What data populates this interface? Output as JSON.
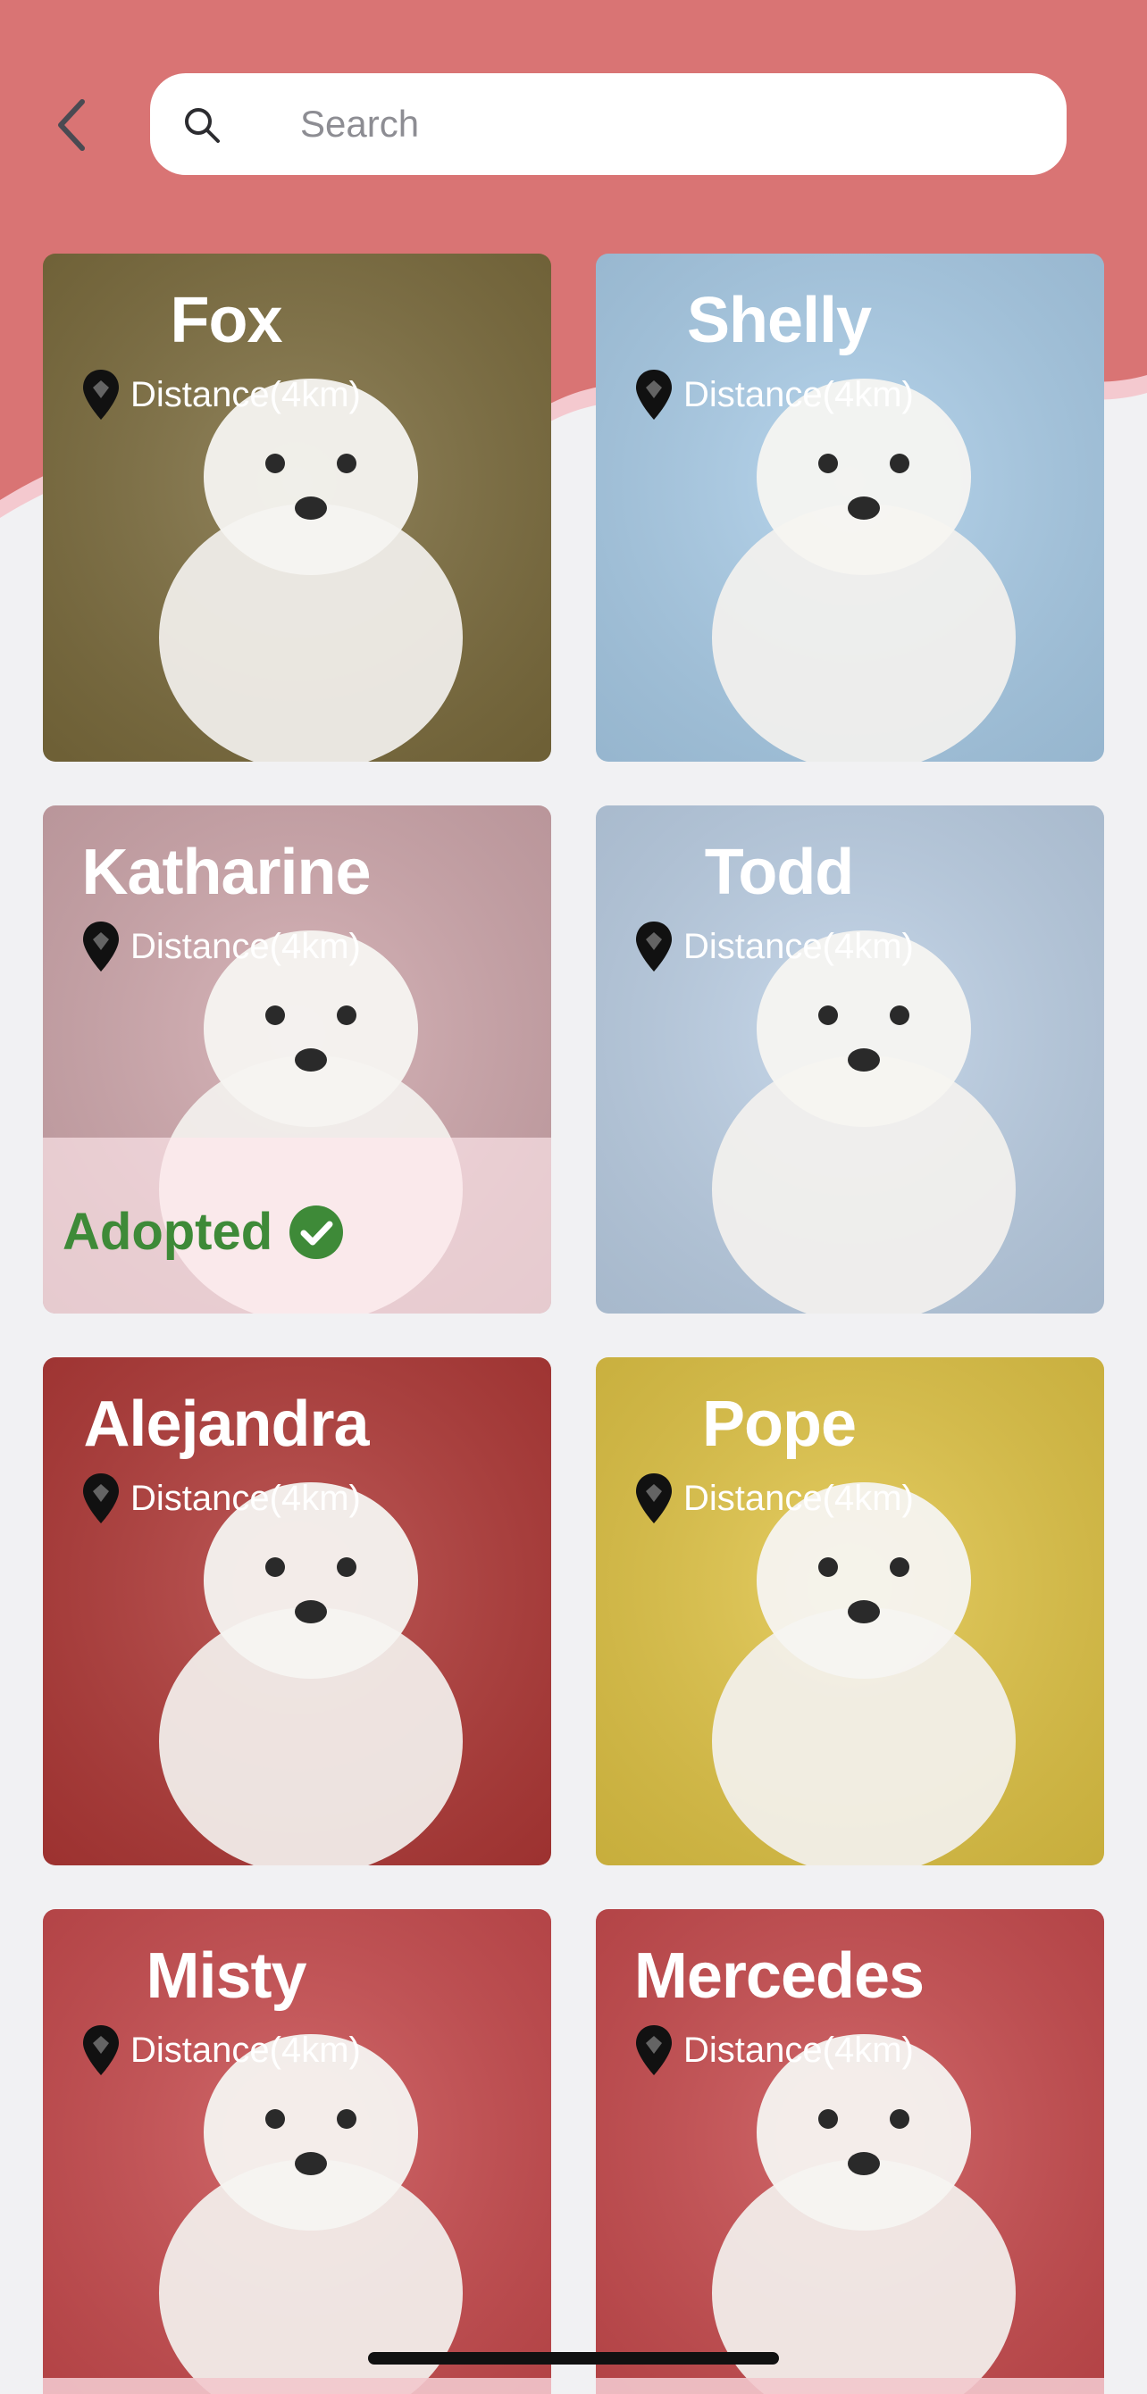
{
  "colors": {
    "header_bg": "#d97474",
    "accent_pink": "#f4c9cf",
    "page_bg": "#f1f1f3",
    "adopted_green": "#3e8a38"
  },
  "search": {
    "placeholder": "Search",
    "value": ""
  },
  "icons": {
    "back": "chevron-left-icon",
    "search": "search-icon",
    "pin": "location-pin-icon",
    "check": "check-circle-icon"
  },
  "pets": [
    {
      "name": "Fox",
      "distance": "Distance(4km)",
      "adopted": false,
      "bg": "#7a6a3a"
    },
    {
      "name": "Shelly",
      "distance": "Distance(4km)",
      "adopted": false,
      "bg": "#a9cde9"
    },
    {
      "name": "Katharine",
      "distance": "Distance(4km)",
      "adopted": true,
      "adopted_label": "Adopted",
      "bg": "#cfa6ab"
    },
    {
      "name": "Todd",
      "distance": "Distance(4km)",
      "adopted": false,
      "bg": "#bcd0e6"
    },
    {
      "name": "Alejandra",
      "distance": "Distance(4km)",
      "adopted": false,
      "bg": "#b03634"
    },
    {
      "name": "Pope",
      "distance": "Distance(4km)",
      "adopted": false,
      "bg": "#e1c442"
    },
    {
      "name": "Misty",
      "distance": "Distance(4km)",
      "adopted": false,
      "bg": "#c8484b"
    },
    {
      "name": "Mercedes",
      "distance": "Distance(4km)",
      "adopted": false,
      "bg": "#c8484b"
    }
  ]
}
